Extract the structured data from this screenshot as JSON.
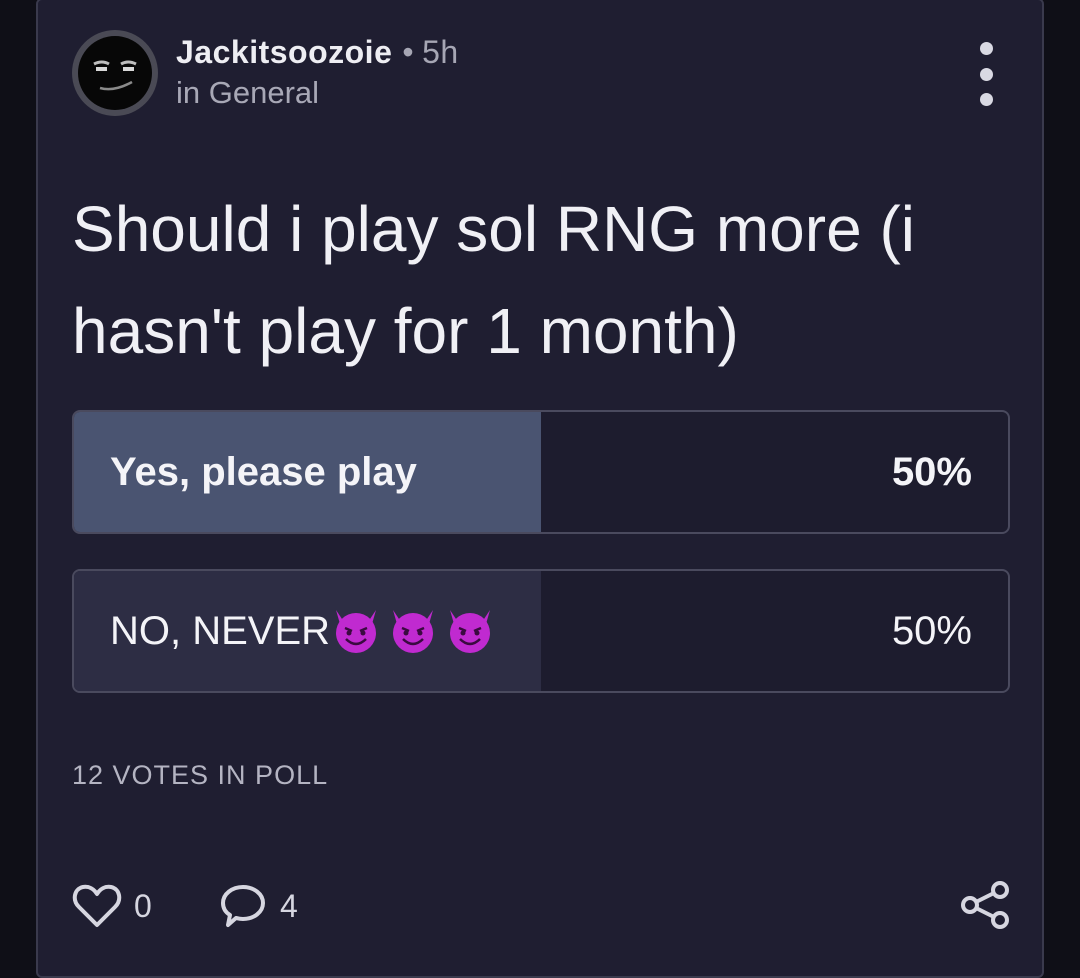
{
  "post": {
    "author": "Jackitsoozoie",
    "separator": "•",
    "time": "5h",
    "category": "in General",
    "title": "Should i play sol RNG more (i hasn't play for 1 month)"
  },
  "poll": {
    "options": [
      {
        "label": "Yes, please play",
        "percent_label": "50%",
        "percent": 50,
        "selected": true
      },
      {
        "label": "NO, NEVER",
        "percent_label": "50%",
        "percent": 50,
        "selected": false,
        "emoji_icons": [
          "smiling-imp-icon",
          "smiling-imp-icon",
          "smiling-imp-icon"
        ]
      }
    ],
    "votes_label": "12 VOTES IN POLL"
  },
  "actions": {
    "likes": "0",
    "comments": "4"
  },
  "colors": {
    "background": "#0f0f17",
    "card": "#1f1e31",
    "selected_fill": "#4a5471",
    "unselected_fill": "#2d2d44",
    "devil_purple": "#c02ad0"
  }
}
